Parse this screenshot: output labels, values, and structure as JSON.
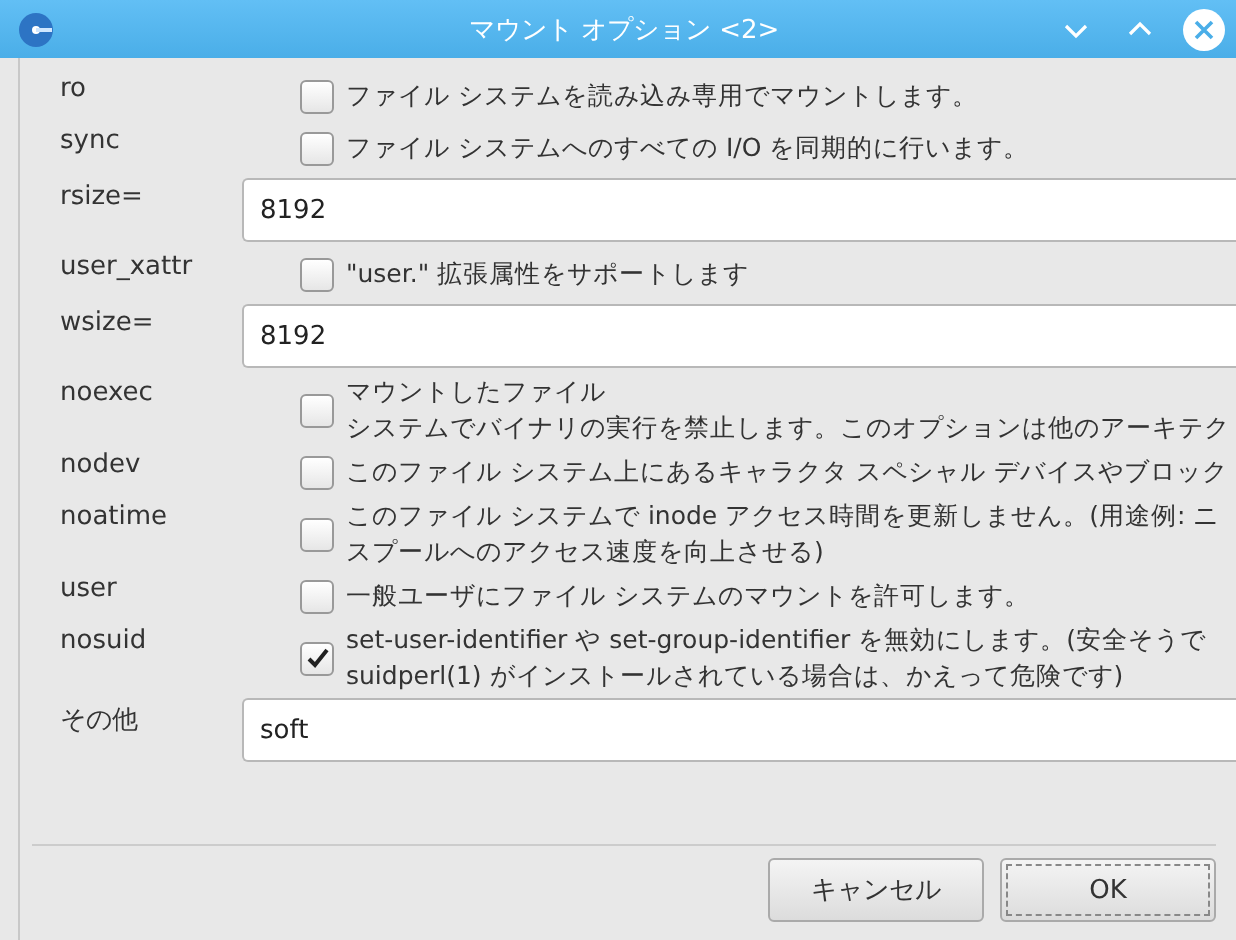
{
  "window": {
    "title": "マウント オプション <2>"
  },
  "options": [
    {
      "kind": "check",
      "label": "ro",
      "checked": false,
      "lines": [
        "ファイル システムを読み込み専用でマウントします。"
      ]
    },
    {
      "kind": "check",
      "label": "sync",
      "checked": false,
      "lines": [
        "ファイル システムへのすべての I/O を同期的に行います。"
      ]
    },
    {
      "kind": "field",
      "label": "rsize=",
      "value": "8192"
    },
    {
      "kind": "check",
      "label": "user_xattr",
      "checked": false,
      "lines": [
        "\"user.\" 拡張属性をサポートします"
      ]
    },
    {
      "kind": "field",
      "label": "wsize=",
      "value": "8192"
    },
    {
      "kind": "check",
      "label": "noexec",
      "checked": false,
      "lines": [
        "マウントしたファイル",
        "システムでバイナリの実行を禁止します。このオプションは他のアーキテク"
      ]
    },
    {
      "kind": "check",
      "label": "nodev",
      "checked": false,
      "lines": [
        "このファイル システム上にあるキャラクタ スペシャル デバイスやブロック"
      ]
    },
    {
      "kind": "check",
      "label": "noatime",
      "checked": false,
      "lines": [
        "このファイル システムで inode アクセス時間を更新しません。(用途例: ニ",
        "スプールへのアクセス速度を向上させる)"
      ]
    },
    {
      "kind": "check",
      "label": "user",
      "checked": false,
      "lines": [
        "一般ユーザにファイル システムのマウントを許可します。"
      ]
    },
    {
      "kind": "check",
      "label": "nosuid",
      "checked": true,
      "lines": [
        "set-user-identifier や set-group-identifier を無効にします。(安全そうで",
        "suidperl(1) がインストールされている場合は、かえって危険です)"
      ]
    },
    {
      "kind": "field",
      "label": "その他",
      "value": "soft"
    }
  ],
  "buttons": [
    {
      "label": "キャンセル",
      "selected": false
    },
    {
      "label": "OK",
      "selected": true
    }
  ]
}
